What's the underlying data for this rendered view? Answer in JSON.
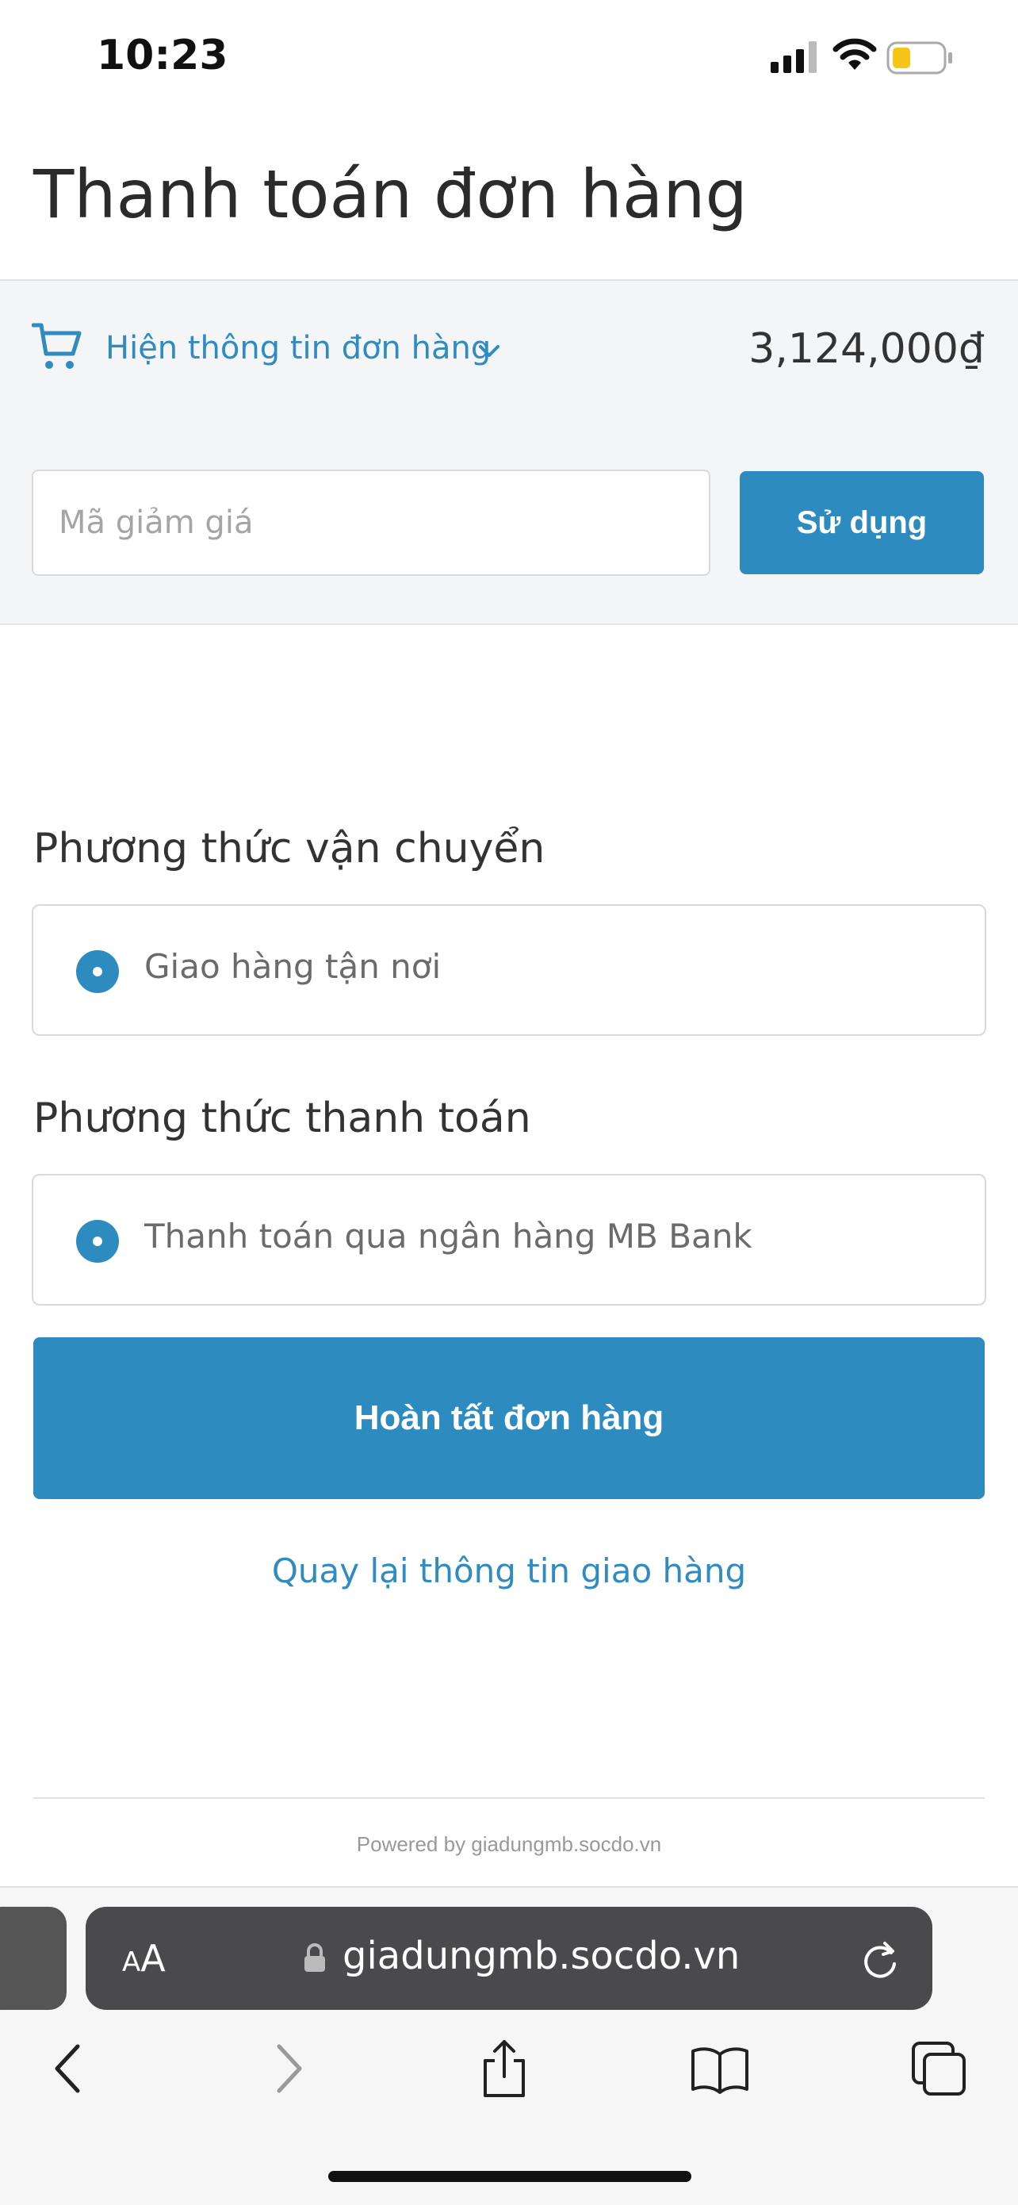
{
  "status_bar": {
    "time": "10:23",
    "icons": [
      "signal-icon",
      "wifi-icon",
      "battery-icon"
    ],
    "battery_color": "#f5c518"
  },
  "page": {
    "title": "Thanh toán đơn hàng"
  },
  "order_summary": {
    "toggle_label": "Hiện thông tin đơn hàng",
    "total": "3,124,000₫",
    "icons": [
      "cart-icon",
      "chevron-down-icon"
    ]
  },
  "discount": {
    "placeholder": "Mã giảm giá",
    "value": "",
    "apply_label": "Sử dụng"
  },
  "shipping": {
    "heading": "Phương thức vận chuyển",
    "option_label": "Giao hàng tận nơi",
    "selected": true
  },
  "payment": {
    "heading": "Phương thức thanh toán",
    "option_label": "Thanh toán qua ngân hàng MB Bank",
    "selected": true
  },
  "actions": {
    "complete_label": "Hoàn tất đơn hàng",
    "back_label": "Quay lại thông tin giao hàng"
  },
  "footer": {
    "powered_by": "Powered by giadungmb.socdo.vn"
  },
  "browser": {
    "aa_small": "A",
    "aa_big": "A",
    "url": "giadungmb.socdo.vn",
    "toolbar_icons": [
      "back-icon",
      "forward-icon",
      "share-icon",
      "bookmarks-icon",
      "tabs-icon"
    ]
  },
  "colors": {
    "accent": "#2d8bc0",
    "link": "#2f8bc0",
    "band_background": "#f4f5f7"
  }
}
